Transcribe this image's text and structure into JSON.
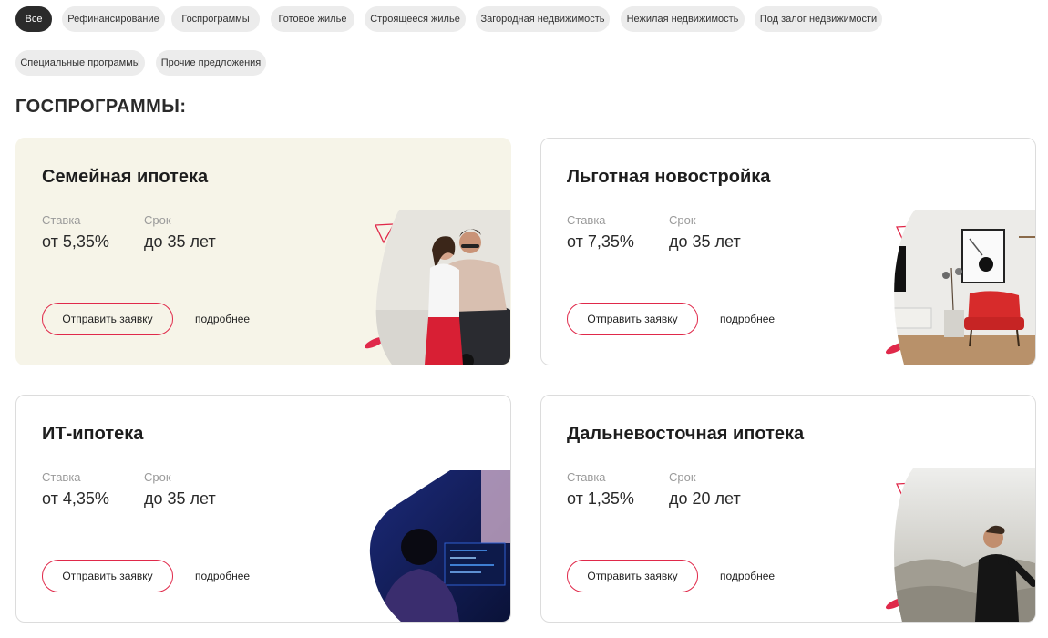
{
  "filters": [
    {
      "label": "Все",
      "active": true
    },
    {
      "label": "Рефинансирование"
    },
    {
      "label": "Госпрограммы"
    },
    {
      "label": "Готовое жилье"
    },
    {
      "label": "Строящееся жилье"
    },
    {
      "label": "Загородная недвижимость"
    },
    {
      "label": "Нежилая недвижимость"
    },
    {
      "label": "Под залог недвижимости"
    },
    {
      "label": "Специальные программы"
    },
    {
      "label": "Прочие предложения"
    }
  ],
  "section": {
    "title": "ГОСПРОГРАММЫ:"
  },
  "cards": [
    {
      "title": "Семейная ипотека",
      "rate_label": "Ставка",
      "rate": "от 5,35%",
      "term_label": "Срок",
      "term": "до 35 лет",
      "apply_label": "Отправить заявку",
      "more_label": "подробнее",
      "image": "family-couple-photo"
    },
    {
      "title": "Льготная новостройка",
      "rate_label": "Ставка",
      "rate": "от 7,35%",
      "term_label": "Срок",
      "term": "до 35 лет",
      "apply_label": "Отправить заявку",
      "more_label": "подробнее",
      "image": "interior-red-chair-photo"
    },
    {
      "title": "ИТ-ипотека",
      "rate_label": "Ставка",
      "rate": "от 4,35%",
      "term_label": "Срок",
      "term": "до 35 лет",
      "apply_label": "Отправить заявку",
      "more_label": "подробнее",
      "image": "programmer-monitors-photo"
    },
    {
      "title": "Дальневосточная ипотека",
      "rate_label": "Ставка",
      "rate": "от 1,35%",
      "term_label": "Срок",
      "term": "до 20 лет",
      "apply_label": "Отправить заявку",
      "more_label": "подробнее",
      "image": "man-mountains-photo"
    }
  ],
  "colors": {
    "accent": "#e0294a",
    "chip": "#ececec",
    "chip_active": "#2b2b2b",
    "card_beige": "#f6f4e8"
  }
}
